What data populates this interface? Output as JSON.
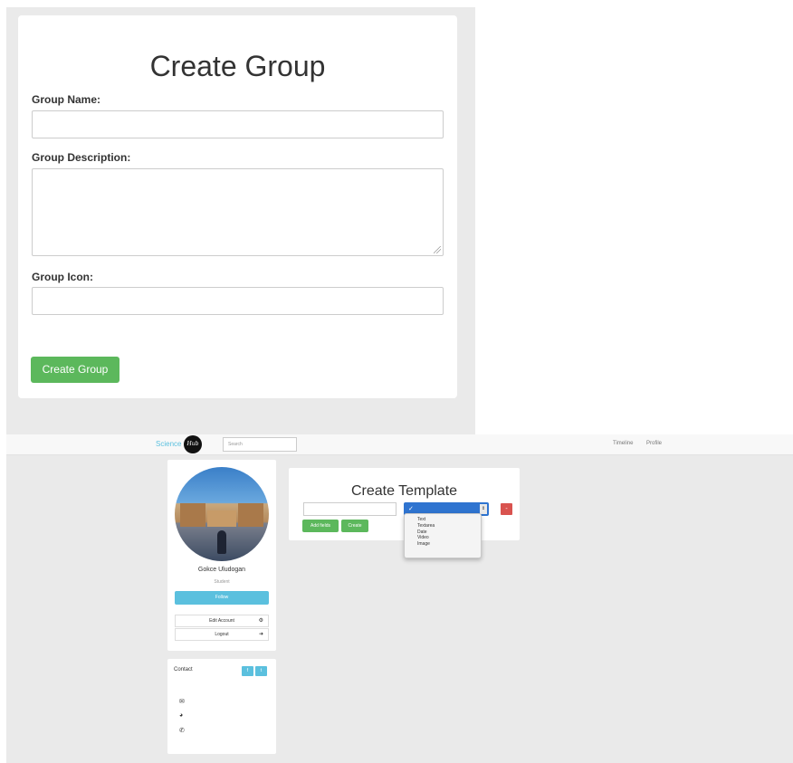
{
  "group_form": {
    "title": "Create Group",
    "name_label": "Group Name:",
    "name_value": "",
    "description_label": "Group Description:",
    "description_value": "",
    "icon_label": "Group Icon:",
    "icon_value": "",
    "submit_label": "Create Group"
  },
  "navbar": {
    "brand_text": "Science",
    "brand_badge": "Hub",
    "search_placeholder": "Search",
    "links": [
      "Timeline",
      "Profile"
    ]
  },
  "profile": {
    "name": "Gokce Uludogan",
    "role": "Student",
    "follow_label": "Follow",
    "edit_account_label": "Edit Account",
    "logout_label": "Logout"
  },
  "contact": {
    "title": "Contact",
    "social": [
      "f",
      "t"
    ]
  },
  "template_form": {
    "title": "Create Template",
    "field_value": "",
    "selected_type": "✓",
    "type_options": [
      "Text",
      "Textarea",
      "Date",
      "Video",
      "Image"
    ],
    "delete_label": "-",
    "add_field_label": "Add fields",
    "create_label": "Create"
  },
  "icons": {
    "edit_account": "gear-icon",
    "logout": "sign-out-icon",
    "email": "envelope-icon",
    "web": "globe-icon",
    "phone": "phone-icon"
  },
  "colors": {
    "success": "#5cb85c",
    "info": "#5bc0de",
    "danger": "#d9534f",
    "select_highlight": "#2f74d0"
  }
}
